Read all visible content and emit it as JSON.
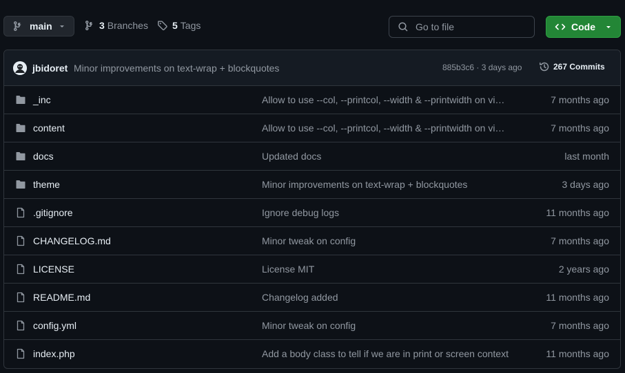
{
  "branch": {
    "name": "main"
  },
  "branches": {
    "count": "3",
    "label": "Branches"
  },
  "tags": {
    "count": "5",
    "label": "Tags"
  },
  "search": {
    "placeholder": "Go to file",
    "value": ""
  },
  "code_button": {
    "label": "Code"
  },
  "latest_commit": {
    "author": "jbidoret",
    "message": "Minor improvements on text-wrap + blockquotes",
    "meta": "885b3c6 · 3 days ago",
    "commits_label": "267 Commits"
  },
  "files": [
    {
      "type": "folder",
      "name": "_inc",
      "message": "Allow to use --col, --printcol, --width & --printwidth on vi…",
      "date": "7 months ago"
    },
    {
      "type": "folder",
      "name": "content",
      "message": "Allow to use --col, --printcol, --width & --printwidth on vi…",
      "date": "7 months ago"
    },
    {
      "type": "folder",
      "name": "docs",
      "message": "Updated docs",
      "date": "last month"
    },
    {
      "type": "folder",
      "name": "theme",
      "message": "Minor improvements on text-wrap + blockquotes",
      "date": "3 days ago"
    },
    {
      "type": "file",
      "name": ".gitignore",
      "message": "Ignore debug logs",
      "date": "11 months ago"
    },
    {
      "type": "file",
      "name": "CHANGELOG.md",
      "message": "Minor tweak on config",
      "date": "7 months ago"
    },
    {
      "type": "file",
      "name": "LICENSE",
      "message": "License MIT",
      "date": "2 years ago"
    },
    {
      "type": "file",
      "name": "README.md",
      "message": "Changelog added",
      "date": "11 months ago"
    },
    {
      "type": "file",
      "name": "config.yml",
      "message": "Minor tweak on config",
      "date": "7 months ago"
    },
    {
      "type": "file",
      "name": "index.php",
      "message": "Add a body class to tell if we are in print or screen context",
      "date": "11 months ago"
    }
  ],
  "colors": {
    "background": "#0d1117",
    "accent_green": "#238636",
    "muted_text": "#9198a1",
    "border": "#30363d",
    "folder_icon": "#9198a1"
  },
  "icons": {
    "branch": "git-branch-icon",
    "tag": "tag-icon",
    "search": "search-icon",
    "code": "code-icon",
    "history": "history-icon",
    "folder": "folder-icon",
    "file": "file-icon"
  }
}
